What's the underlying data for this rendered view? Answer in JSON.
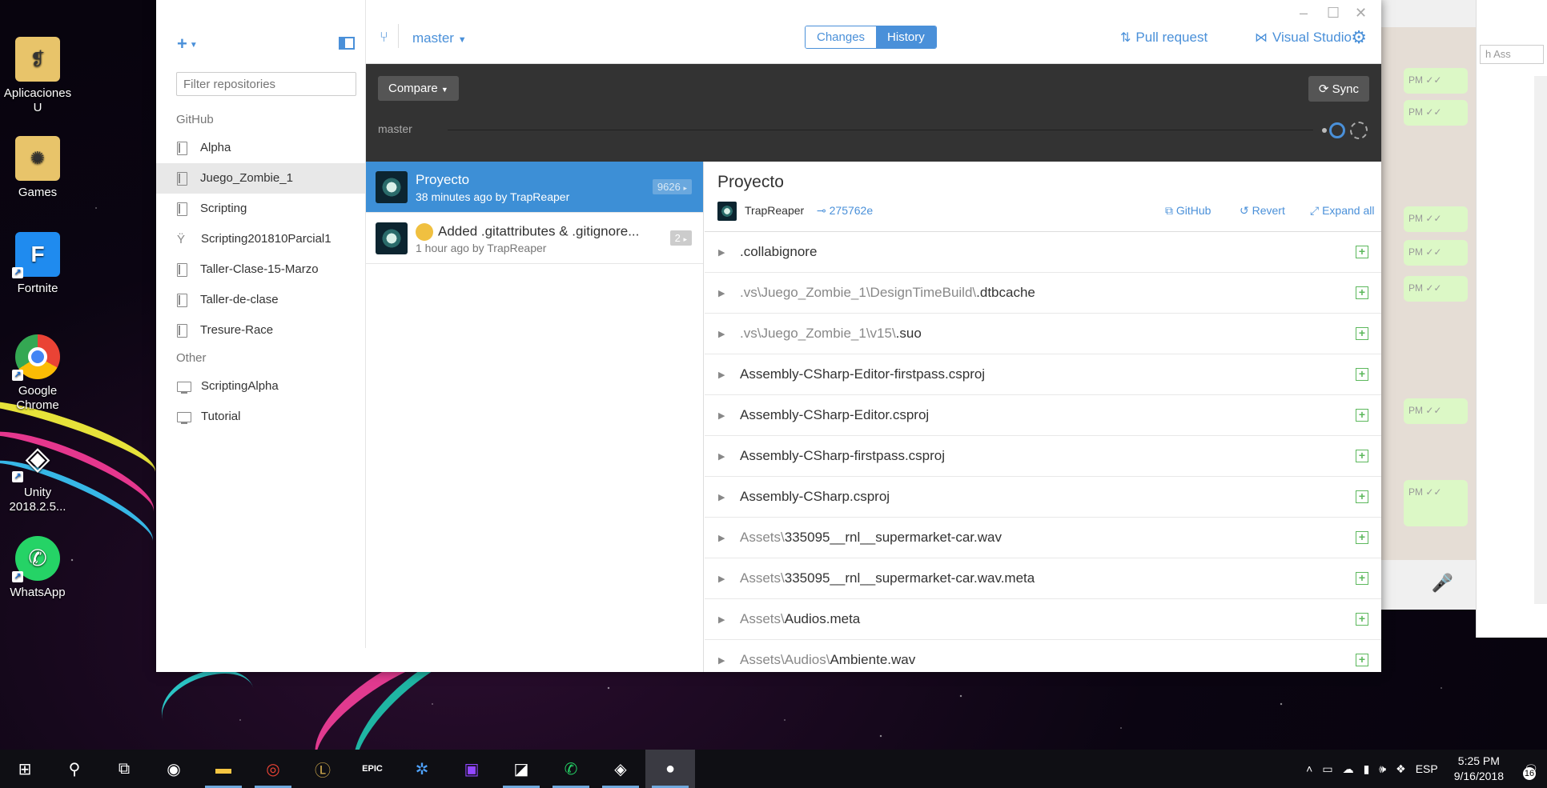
{
  "desktop": {
    "icons": [
      {
        "label": "Aplicaciones U",
        "icon": "folder-icon",
        "color": "#e8c46a"
      },
      {
        "label": "Games",
        "icon": "folder-icon",
        "color": "#e8c46a"
      },
      {
        "label": "Fortnite",
        "icon": "fortnite-icon",
        "color": "#1f8bef"
      },
      {
        "label": "Google Chrome",
        "icon": "chrome-icon",
        "color": "#ea4335"
      },
      {
        "label": "Unity 2018.2.5...",
        "icon": "unity-icon",
        "color": "#222222"
      },
      {
        "label": "WhatsApp",
        "icon": "whatsapp-icon",
        "color": "#25d366"
      }
    ],
    "explorer_search_placeholder": "h Ass"
  },
  "app": {
    "sidebar": {
      "filter_placeholder": "Filter repositories",
      "sections": [
        {
          "title": "GitHub",
          "items": [
            "Alpha",
            "Juego_Zombie_1",
            "Scripting",
            "Scripting201810Parcial1",
            "Taller-Clase-15-Marzo",
            "Taller-de-clase",
            "Tresure-Race"
          ]
        },
        {
          "title": "Other",
          "items": [
            "ScriptingAlpha",
            "Tutorial"
          ]
        }
      ],
      "active_item": "Juego_Zombie_1"
    },
    "toolbar": {
      "branch": "master",
      "tabs": [
        "Changes",
        "History"
      ],
      "active_tab": "History",
      "pull_request": "Pull request",
      "visual_studio": "Visual Studio"
    },
    "compare_bar": {
      "compare_label": "Compare",
      "sync_label": "Sync",
      "branch_label": "master"
    },
    "commits": [
      {
        "message": "Proyecto",
        "meta": "38 minutes ago by TrapReaper",
        "count": "9626"
      },
      {
        "message": "Added .gitattributes & .gitignore...",
        "meta": "1 hour ago by TrapReaper",
        "count": "2"
      }
    ],
    "detail": {
      "title": "Proyecto",
      "author": "TrapReaper",
      "sha": "275762e",
      "github_link": "GitHub",
      "revert_link": "Revert",
      "expand_link": "Expand all",
      "files": [
        {
          "dir": "",
          "name": ".collabignore"
        },
        {
          "dir": ".vs\\Juego_Zombie_1\\DesignTimeBuild\\",
          "name": ".dtbcache"
        },
        {
          "dir": ".vs\\Juego_Zombie_1\\v15\\",
          "name": ".suo"
        },
        {
          "dir": "",
          "name": "Assembly-CSharp-Editor-firstpass.csproj"
        },
        {
          "dir": "",
          "name": "Assembly-CSharp-Editor.csproj"
        },
        {
          "dir": "",
          "name": "Assembly-CSharp-firstpass.csproj"
        },
        {
          "dir": "",
          "name": "Assembly-CSharp.csproj"
        },
        {
          "dir": "Assets\\",
          "name": "335095__rnl__supermarket-car.wav"
        },
        {
          "dir": "Assets\\",
          "name": "335095__rnl__supermarket-car.wav.meta"
        },
        {
          "dir": "Assets\\",
          "name": "Audios.meta"
        },
        {
          "dir": "Assets\\Audios\\",
          "name": "Ambiente.wav"
        }
      ]
    }
  },
  "taskbar": {
    "language": "ESP",
    "time": "5:25 PM",
    "date": "9/16/2018",
    "notifications": "16"
  }
}
